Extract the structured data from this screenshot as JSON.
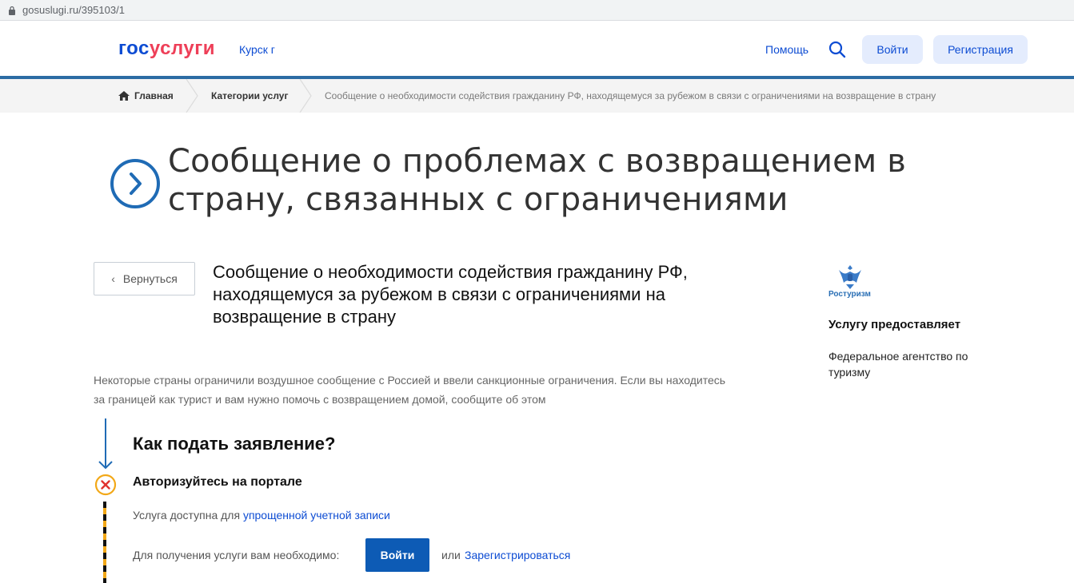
{
  "browser": {
    "url": "gosuslugi.ru/395103/1"
  },
  "header": {
    "logo_part1": "гос",
    "logo_part2": "услуги",
    "region": "Курск г",
    "help": "Помощь",
    "login": "Войти",
    "register": "Регистрация",
    "brand_color": "#0d4cd3",
    "accent_color": "#ee3f58"
  },
  "breadcrumb": {
    "home": "Главная",
    "categories": "Категории услуг",
    "current": "Сообщение о необходимости содействия гражданину РФ, находящемуся за рубежом в связи с ограничениями на возвращение в страну"
  },
  "page": {
    "title": "Сообщение о проблемах с возвращением в страну, связанных с ограничениями",
    "back": "Вернуться",
    "service_title": "Сообщение о необходимости содействия гражданину РФ, находящемуся за рубежом в связи с ограничениями на возвращение в страну",
    "description": "Некоторые страны ограничили воздушное сообщение с Россией и ввели санкционные ограничения. Если вы находитесь за границей как турист и вам нужно помочь с возвращением домой, сообщите об этом"
  },
  "provider": {
    "logo_text": "Ростуризм",
    "label": "Услугу предоставляет",
    "name": "Федеральное агентство по туризму"
  },
  "steps": {
    "how_title": "Как подать заявление?",
    "step1_title": "Авторизуйтесь на портале",
    "account_prefix": "Услуга доступна для",
    "account_link": "упрощенной учетной записи",
    "need_text": "Для получения услуги вам необходимо:",
    "login_button": "Войти",
    "or": "или",
    "register_link": "Зарегистрироваться"
  }
}
